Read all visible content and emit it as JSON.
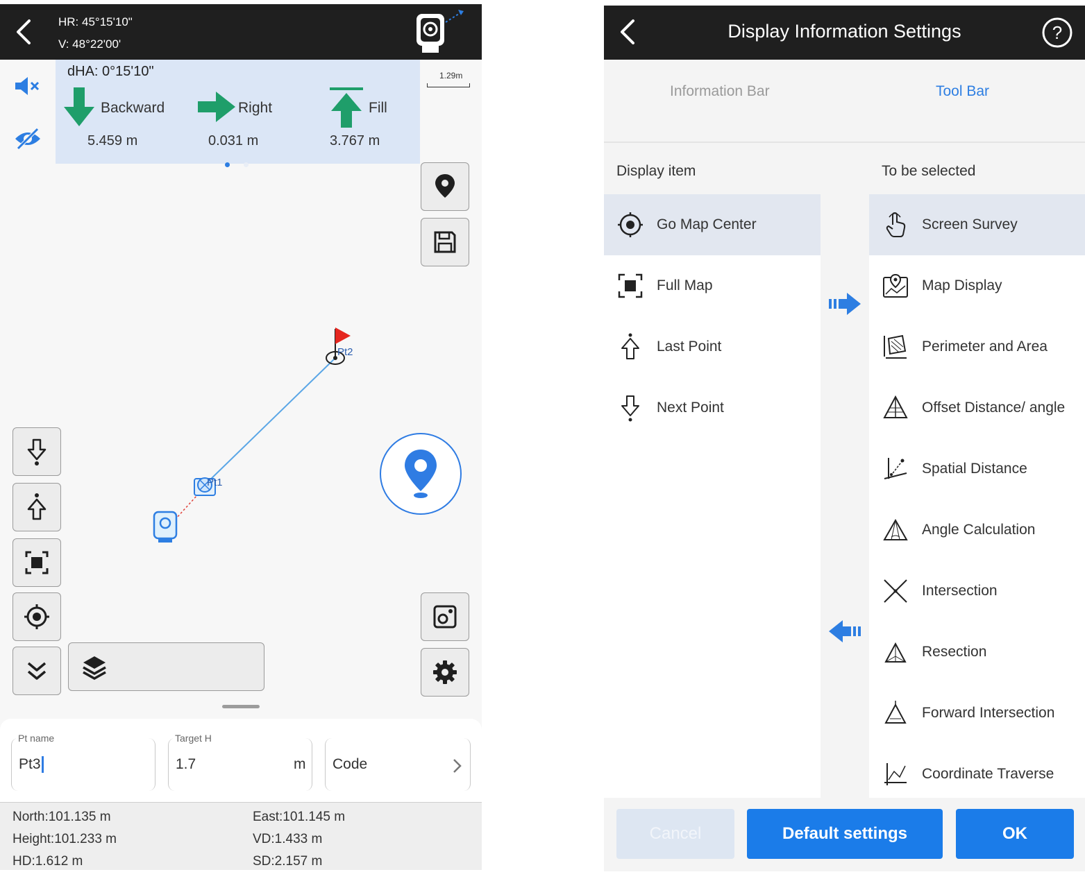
{
  "stakeout": {
    "header": {
      "hr": "HR: 45°15'10\"",
      "v": "V: 48°22'00'"
    },
    "info": {
      "dha": "dHA: 0°15'10\"",
      "directions": [
        {
          "label": "Backward",
          "value": "5.459 m",
          "icon": "arrow-down-icon"
        },
        {
          "label": "Right",
          "value": "0.031 m",
          "icon": "arrow-right-icon"
        },
        {
          "label": "Fill",
          "value": "3.767 m",
          "icon": "arrow-up-bar-icon"
        }
      ],
      "page": 1,
      "pages": 2
    },
    "scale": "1.29m",
    "map": {
      "points": [
        "Pt1",
        "Pt2"
      ]
    },
    "form": {
      "pt_name_label": "Pt name",
      "pt_name_value": "Pt3",
      "target_h_label": "Target H",
      "target_h_value": "1.7",
      "target_h_unit": "m",
      "code_placeholder": "Code"
    },
    "coords": {
      "north": "North:101.135 m",
      "east": "East:101.145 m",
      "height": "Height:101.233 m",
      "vd": "VD:1.433 m",
      "hd": "HD:1.612 m",
      "sd": "SD:2.157 m"
    },
    "colors": {
      "accent": "#2d7ee2",
      "arrow": "#1f9e6a",
      "bar": "#1f1f1f",
      "info_bg": "#dbe6f6"
    }
  },
  "settings": {
    "title": "Display Information Settings",
    "tabs": [
      {
        "label": "Information Bar",
        "active": false
      },
      {
        "label": "Tool Bar",
        "active": true
      }
    ],
    "display_header": "Display item",
    "select_header": "To be selected",
    "display_items": [
      {
        "label": "Go Map Center",
        "icon": "target-icon",
        "selected": true
      },
      {
        "label": "Full Map",
        "icon": "full-map-icon"
      },
      {
        "label": "Last Point",
        "icon": "last-point-icon"
      },
      {
        "label": "Next Point",
        "icon": "next-point-icon"
      }
    ],
    "candidate_items": [
      {
        "label": "Screen Survey",
        "icon": "hand-pointer-icon",
        "selected": true
      },
      {
        "label": "Map Display",
        "icon": "map-display-icon"
      },
      {
        "label": "Perimeter and Area",
        "icon": "perimeter-area-icon"
      },
      {
        "label": "Offset Distance/ angle",
        "icon": "offset-icon"
      },
      {
        "label": "Spatial Distance",
        "icon": "spatial-distance-icon"
      },
      {
        "label": "Angle Calculation",
        "icon": "angle-calc-icon"
      },
      {
        "label": "Intersection",
        "icon": "intersection-icon"
      },
      {
        "label": "Resection",
        "icon": "resection-icon"
      },
      {
        "label": "Forward Intersection",
        "icon": "forward-intersection-icon"
      },
      {
        "label": "Coordinate Traverse",
        "icon": "coordinate-traverse-icon"
      }
    ],
    "buttons": {
      "cancel": "Cancel",
      "default": "Default settings",
      "ok": "OK"
    }
  }
}
